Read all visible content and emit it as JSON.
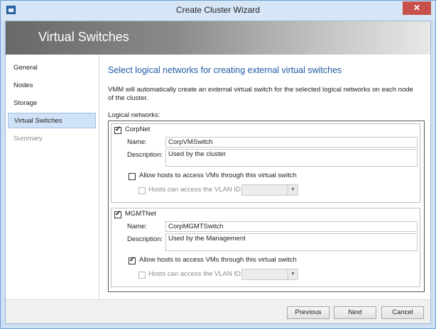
{
  "window": {
    "title": "Create Cluster Wizard",
    "close_symbol": "✕",
    "app_icon": "wizard-icon"
  },
  "banner": {
    "title": "Virtual Switches"
  },
  "nav": {
    "items": [
      {
        "label": "General",
        "state": "normal"
      },
      {
        "label": "Nodes",
        "state": "normal"
      },
      {
        "label": "Storage",
        "state": "normal"
      },
      {
        "label": "Virtual Switches",
        "state": "active"
      },
      {
        "label": "Summary",
        "state": "disabled"
      }
    ]
  },
  "main": {
    "heading": "Select logical networks for creating external virtual switches",
    "description": "VMM will automatically create an external virtual switch for the selected logical networks on each node of the cluster.",
    "logical_networks_label": "Logical networks:"
  },
  "networks": [
    {
      "name": "CorpNet",
      "checked": true,
      "name_label": "Name:",
      "switch_name": "CorpVMSwitch",
      "description_label": "Description:",
      "description": "Used by the cluster",
      "allow_label": "Allow hosts to access VMs through this virtual switch",
      "allow_checked": false,
      "vlan_label": "Hosts can access the VLAN ID:",
      "vlan_checked": false,
      "vlan_value": ""
    },
    {
      "name": "MGMTNet",
      "checked": true,
      "name_label": "Name:",
      "switch_name": "CorpMGMTSwitch",
      "description_label": "Description:",
      "description": "Used by the Management",
      "allow_label": "Allow hosts to access VMs through this virtual switch",
      "allow_checked": true,
      "vlan_label": "Hosts can access the VLAN ID:",
      "vlan_checked": false,
      "vlan_value": ""
    }
  ],
  "footer": {
    "previous_label": "Previous",
    "next_label": "Next",
    "cancel_label": "Cancel"
  }
}
